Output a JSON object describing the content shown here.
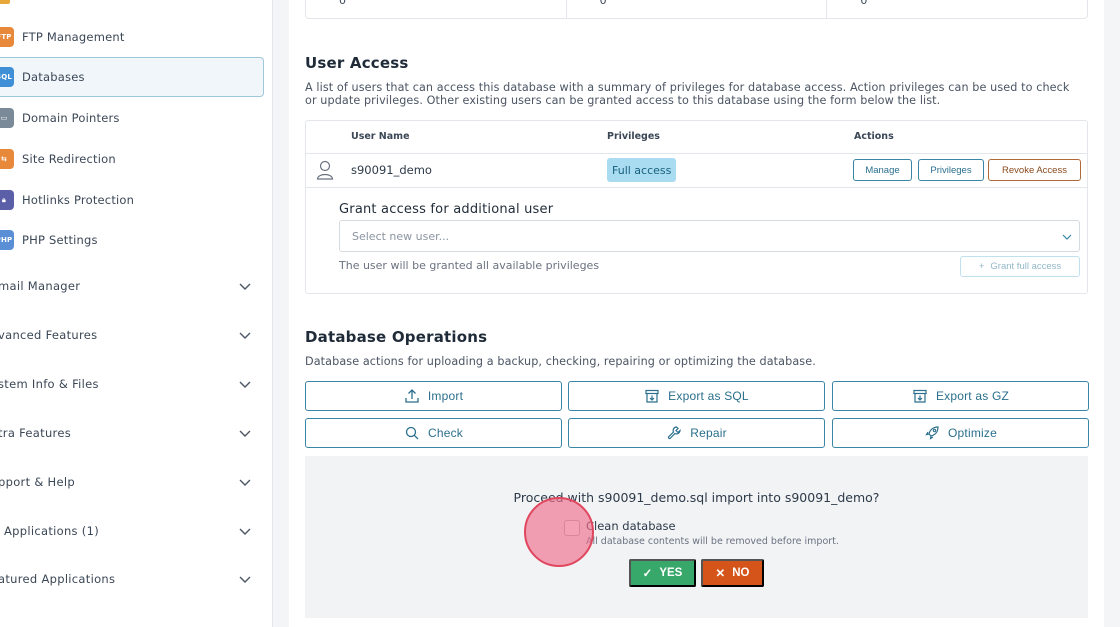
{
  "sidebar": {
    "items": [
      {
        "label": "FTP Management",
        "icon": "ftp-icon",
        "color": "#e8883a"
      },
      {
        "label": "Databases",
        "icon": "sql-database-icon",
        "color": "#3f8fd6"
      },
      {
        "label": "Domain Pointers",
        "icon": "domain-pointer-icon",
        "color": "#7a8a99"
      },
      {
        "label": "Site Redirection",
        "icon": "signpost-icon",
        "color": "#e8883a"
      },
      {
        "label": "Hotlinks Protection",
        "icon": "lock-icon",
        "color": "#5b5fa8"
      },
      {
        "label": "PHP Settings",
        "icon": "php-icon",
        "color": "#5a8fd6"
      }
    ],
    "groups": [
      {
        "label": "mail Manager"
      },
      {
        "label": "vanced Features"
      },
      {
        "label": "stem Info & Files"
      },
      {
        "label": "tra Features"
      },
      {
        "label": "pport & Help"
      },
      {
        "label": "Applications (1)"
      },
      {
        "label": "atured Applications"
      }
    ]
  },
  "stats": [
    "0",
    "0",
    "0"
  ],
  "user_access": {
    "title": "User Access",
    "description": "A list of users that can access this database with a summary of privileges for database access. Action privileges can be used to check or update privileges. Other existing users can be granted access to this database using the form below the list.",
    "columns": {
      "user": "User Name",
      "privileges": "Privileges",
      "actions": "Actions"
    },
    "row": {
      "user": "s90091_demo",
      "privilege": "Full access",
      "manage": "Manage",
      "privileges_btn": "Privileges",
      "revoke": "Revoke Access"
    },
    "grant": {
      "title": "Grant access for additional user",
      "placeholder": "Select new user...",
      "hint": "The user will be granted all available privileges",
      "button": "Grant full access"
    }
  },
  "operations": {
    "title": "Database Operations",
    "description": "Database actions for uploading a backup, checking, repairing or optimizing the database.",
    "buttons": {
      "import": "Import",
      "export_sql": "Export as SQL",
      "export_gz": "Export as GZ",
      "check": "Check",
      "repair": "Repair",
      "optimize": "Optimize"
    }
  },
  "confirm": {
    "question": "Proceed with s90091_demo.sql import into s90091_demo?",
    "checkbox_label": "Clean database",
    "checkbox_hint": "All database contents will be removed before import.",
    "checked": false,
    "yes": "YES",
    "no": "NO"
  },
  "colors": {
    "accent": "#3a86a6",
    "yes": "#37a86a",
    "no": "#d4541a",
    "badge": "#a9dcf0"
  }
}
